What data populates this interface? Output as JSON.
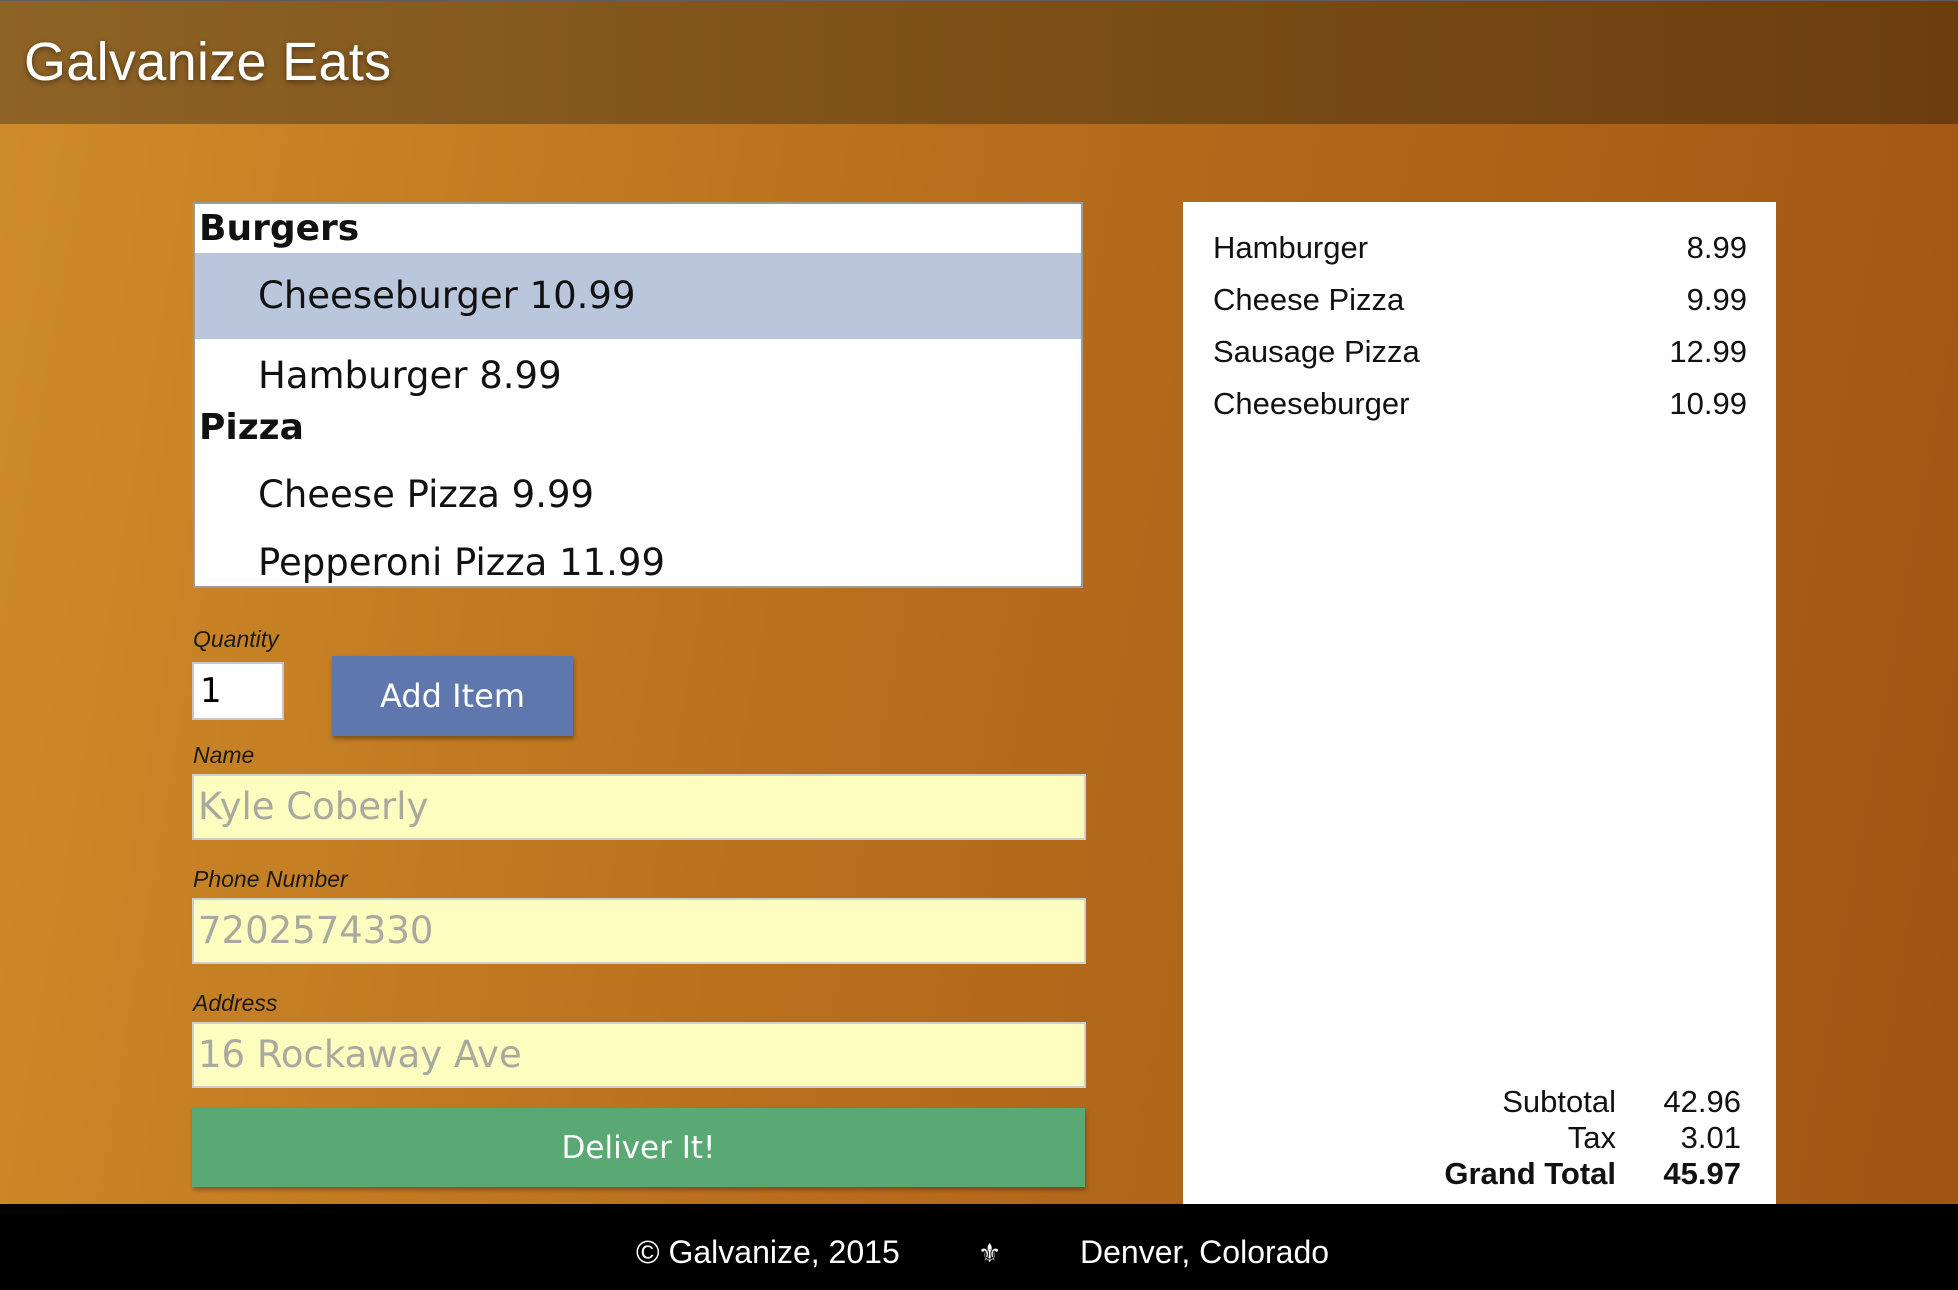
{
  "header": {
    "title": "Galvanize Eats"
  },
  "menu": {
    "groups": [
      {
        "label": "Burgers",
        "items": [
          "Cheeseburger 10.99",
          "Hamburger 8.99"
        ]
      },
      {
        "label": "Pizza",
        "items": [
          "Cheese Pizza 9.99",
          "Pepperoni Pizza 11.99"
        ]
      }
    ],
    "selected": "Cheeseburger 10.99"
  },
  "form": {
    "quantity_label": "Quantity",
    "quantity_value": "1",
    "add_button": "Add Item",
    "name_label": "Name",
    "name_placeholder": "Kyle Coberly",
    "phone_label": "Phone Number",
    "phone_placeholder": "7202574330",
    "address_label": "Address",
    "address_placeholder": "16 Rockaway Ave",
    "deliver_button": "Deliver It!"
  },
  "order": {
    "items": [
      {
        "name": "Hamburger",
        "price": "8.99"
      },
      {
        "name": "Cheese Pizza",
        "price": "9.99"
      },
      {
        "name": "Sausage Pizza",
        "price": "12.99"
      },
      {
        "name": "Cheeseburger",
        "price": "10.99"
      }
    ],
    "subtotal_label": "Subtotal",
    "subtotal": "42.96",
    "tax_label": "Tax",
    "tax": "3.01",
    "grand_total_label": "Grand Total",
    "grand_total": "45.97"
  },
  "footer": {
    "copyright": "© Galvanize, 2015",
    "separator": "⚜",
    "location": "Denver, Colorado"
  }
}
